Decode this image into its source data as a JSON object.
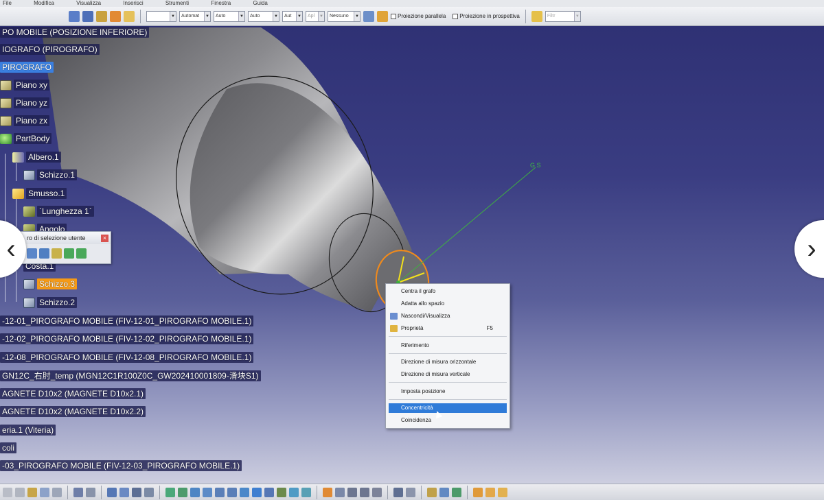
{
  "menubar": {
    "items": [
      "File",
      "Modifica",
      "Visualizza",
      "Inserisci",
      "Strumenti",
      "Finestra",
      "Guida"
    ]
  },
  "toolbar_top": {
    "combo_line": "",
    "combo_automatic": "Automat",
    "combo_auto1": "Auto",
    "combo_auto2": "Auto",
    "combo_aut": "Aut",
    "combo_apl": "Apl",
    "combo_nessuno": "Nessuno",
    "check_parallel": "Proiezione parallela",
    "check_perspective": "Proiezione in prospettiva",
    "filter_placeholder": "Filtr"
  },
  "tree": {
    "nodes": [
      {
        "label": "PO MOBILE (POSIZIONE INFERIORE)"
      },
      {
        "label": "IOGRAFO (PIROGRAFO)"
      },
      {
        "label": "PIROGRAFO"
      },
      {
        "label": "Piano xy"
      },
      {
        "label": "Piano yz"
      },
      {
        "label": "Piano zx"
      },
      {
        "label": "PartBody"
      },
      {
        "label": "Albero.1"
      },
      {
        "label": "Schizzo.1"
      },
      {
        "label": "Smusso.1"
      },
      {
        "label": "`Lunghezza 1`"
      },
      {
        "label": "Angolo"
      },
      {
        "label": "Costa.1"
      },
      {
        "label": "Schizzo.3"
      },
      {
        "label": "Schizzo.2"
      },
      {
        "label": "-12-01_PIROGRAFO MOBILE (FIV-12-01_PIROGRAFO MOBILE.1)"
      },
      {
        "label": "-12-02_PIROGRAFO MOBILE (FIV-12-02_PIROGRAFO MOBILE.1)"
      },
      {
        "label": "-12-08_PIROGRAFO MOBILE (FIV-12-08_PIROGRAFO MOBILE.1)"
      },
      {
        "label": "GN12C_右肘_temp (MGN12C1R100Z0C_GW202410001809-滑块S1)"
      },
      {
        "label": "AGNETE D10x2 (MAGNETE D10x2.1)"
      },
      {
        "label": "AGNETE D10x2 (MAGNETE D10x2.2)"
      },
      {
        "label": "eria.1 (Viteria)"
      },
      {
        "label": "coli"
      },
      {
        "label": "-03_PIROGRAFO MOBILE (FIV-12-03_PIROGRAFO MOBILE.1)"
      }
    ]
  },
  "filter_toolbar": {
    "title": "ro di selezione utente",
    "close": "×"
  },
  "context_menu": {
    "items": [
      {
        "label": "Centra il grafo"
      },
      {
        "label": "Adatta allo spazio"
      },
      {
        "label": "Nascondi/Visualizza"
      },
      {
        "label": "Proprietà",
        "shortcut": "F5"
      },
      {
        "label": "Riferimento"
      },
      {
        "label": "Direzione di misura orizzontale"
      },
      {
        "label": "Direzione di misura verticale"
      },
      {
        "label": "Imposta posizione"
      },
      {
        "label": "Concentricità"
      },
      {
        "label": "Coincidenza"
      }
    ]
  },
  "axis": {
    "label": "G S"
  },
  "nav": {
    "prev": "‹",
    "next": "›"
  },
  "colors": {
    "selection_blue": "#3a7fe0",
    "selection_orange": "#f59a16",
    "menu_highlight": "#2f7bd8",
    "viewport_top": "#2d2f72"
  }
}
